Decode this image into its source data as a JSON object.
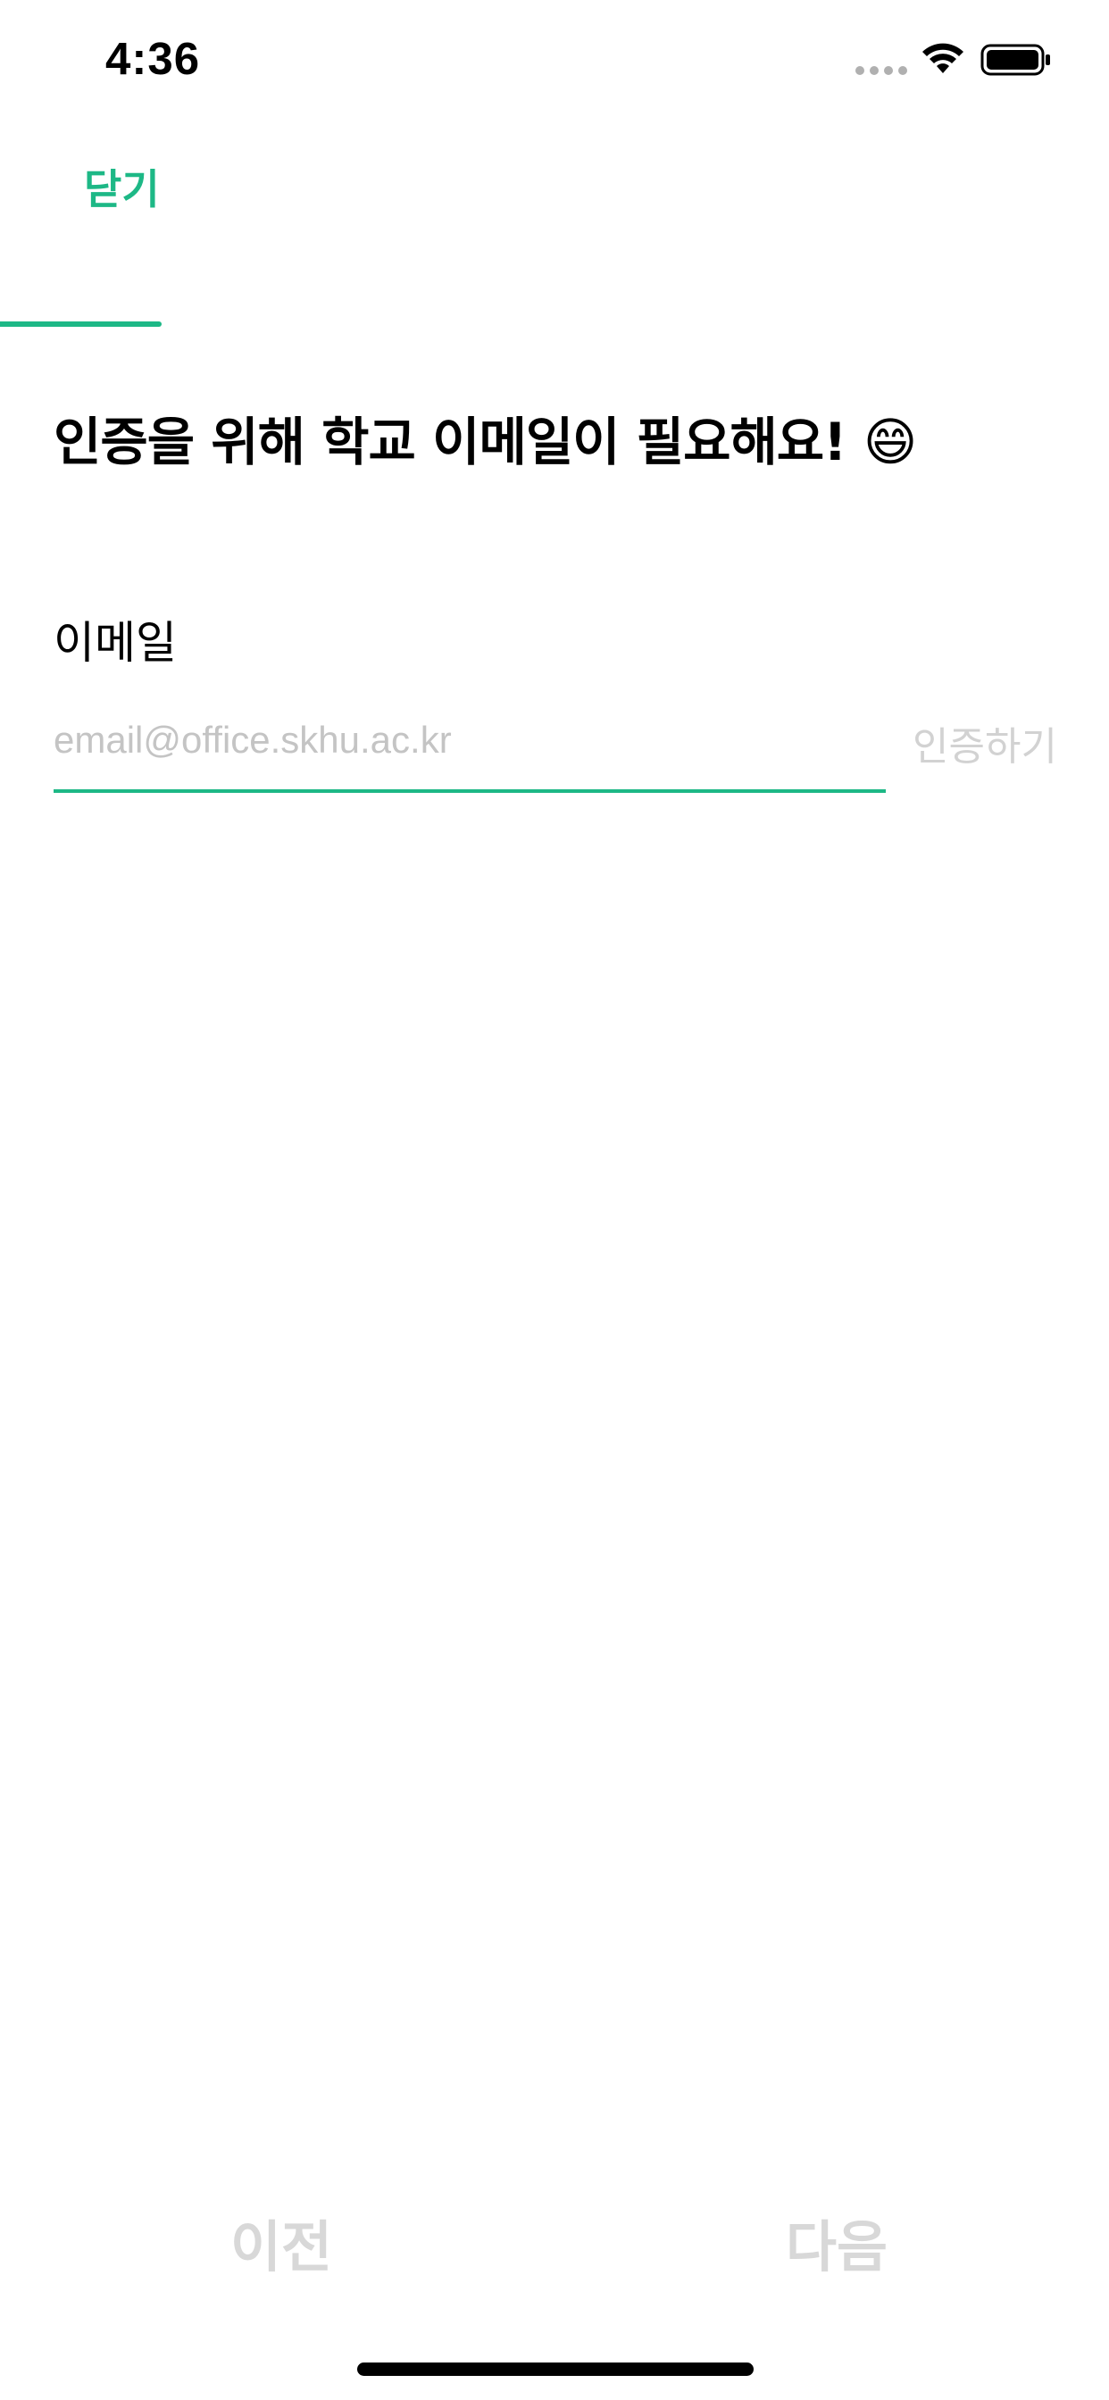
{
  "status_bar": {
    "time": "4:36",
    "icons": [
      "cellular-signal-icon",
      "wifi-icon",
      "battery-icon"
    ]
  },
  "nav": {
    "close_label": "닫기"
  },
  "progress": {
    "fraction": 0.146
  },
  "headline": "인증을 위해 학교 이메일이 필요해요! 😄",
  "email": {
    "label": "이메일",
    "placeholder": "email@office.skhu.ac.kr",
    "value": "",
    "verify_label": "인증하기"
  },
  "bottom_nav": {
    "prev_label": "이전",
    "next_label": "다음"
  },
  "colors": {
    "accent": "#1db886",
    "disabled_text": "#d8d8d8",
    "placeholder": "#c4c4c4"
  }
}
